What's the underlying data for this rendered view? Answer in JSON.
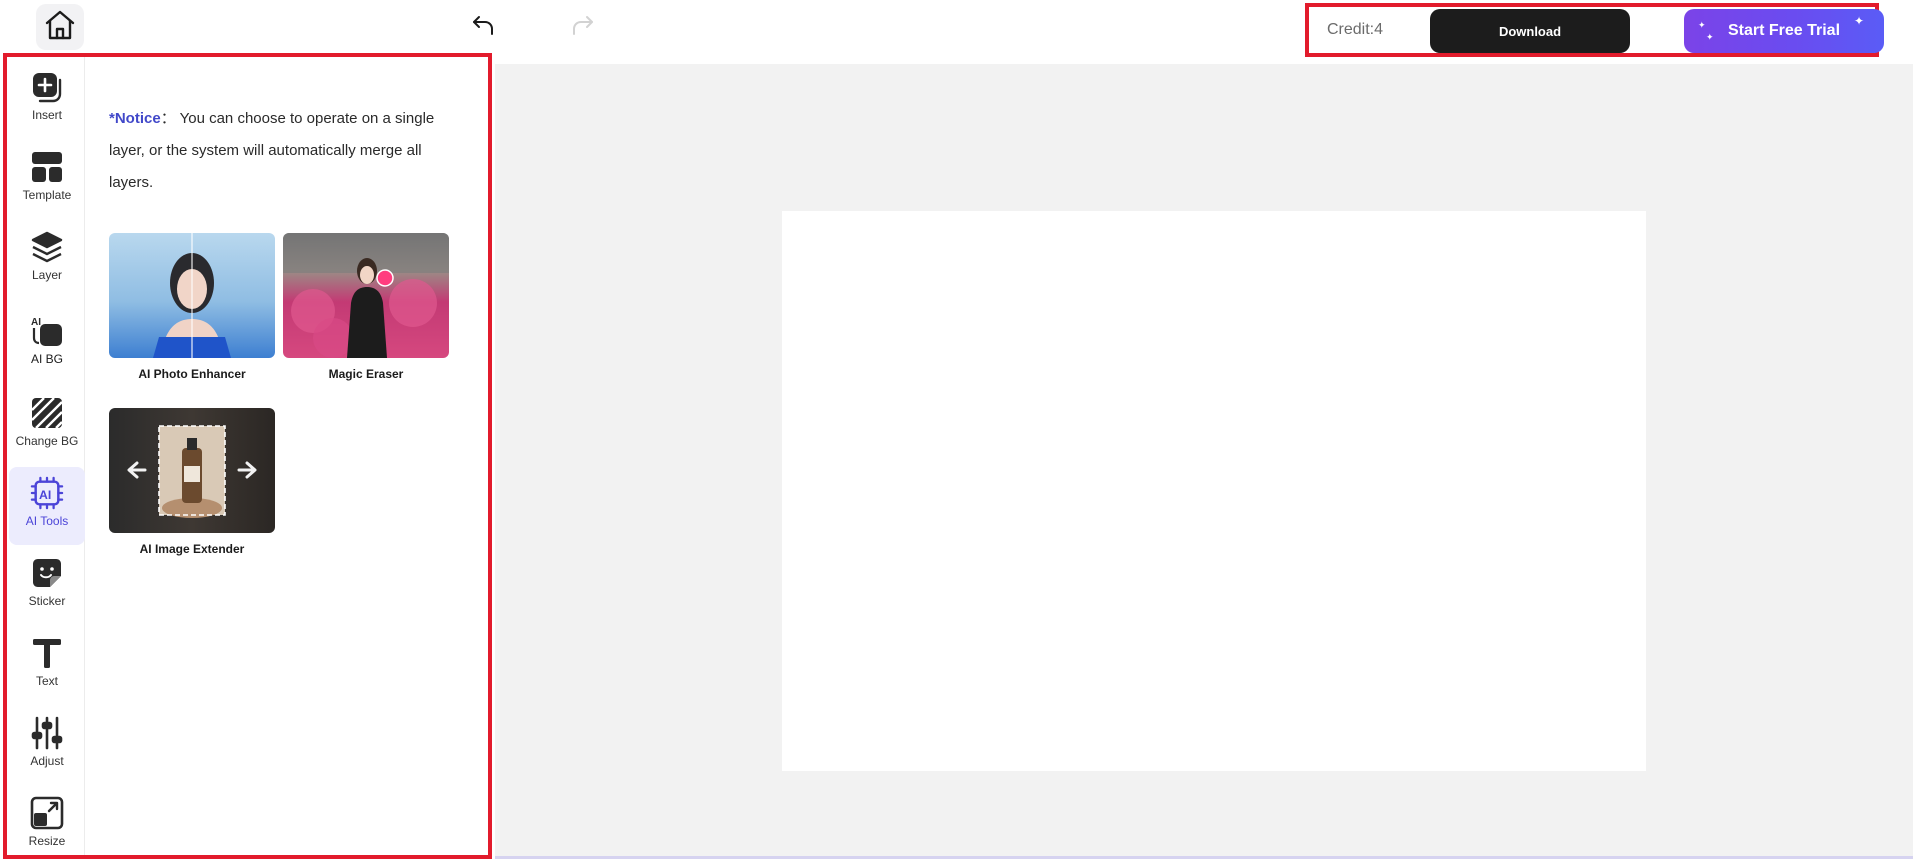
{
  "header": {
    "home_icon": "home-icon",
    "undo_icon": "undo-icon",
    "redo_icon": "redo-icon",
    "credit_text": "Credit:4",
    "download_label": "Download",
    "trial_label": "Start Free Trial"
  },
  "sidebar": {
    "items": [
      {
        "label": "Insert",
        "icon": "insert-icon"
      },
      {
        "label": "Template",
        "icon": "template-icon"
      },
      {
        "label": "Layer",
        "icon": "layer-icon"
      },
      {
        "label": "AI BG",
        "icon": "ai-bg-icon"
      },
      {
        "label": "Change BG",
        "icon": "change-bg-icon"
      },
      {
        "label": "AI Tools",
        "icon": "ai-tools-icon",
        "active": true
      },
      {
        "label": "Sticker",
        "icon": "sticker-icon"
      },
      {
        "label": "Text",
        "icon": "text-icon"
      },
      {
        "label": "Adjust",
        "icon": "adjust-icon"
      },
      {
        "label": "Resize",
        "icon": "resize-icon"
      }
    ]
  },
  "panel": {
    "notice_tag": "*Notice",
    "notice_sep": "：",
    "notice_text": "You can choose to operate on a single layer, or the system will automatically merge all layers.",
    "tools": [
      {
        "label": "AI Photo Enhancer"
      },
      {
        "label": "Magic Eraser"
      },
      {
        "label": "AI Image Extender"
      }
    ]
  },
  "colors": {
    "accent": "#4b44d8",
    "highlight_outline": "#e21b2c",
    "download_bg": "#1c1c1c",
    "trial_gradient_start": "#7b43e8",
    "trial_gradient_end": "#5a5cf6",
    "workspace_bg": "#f2f2f2"
  }
}
